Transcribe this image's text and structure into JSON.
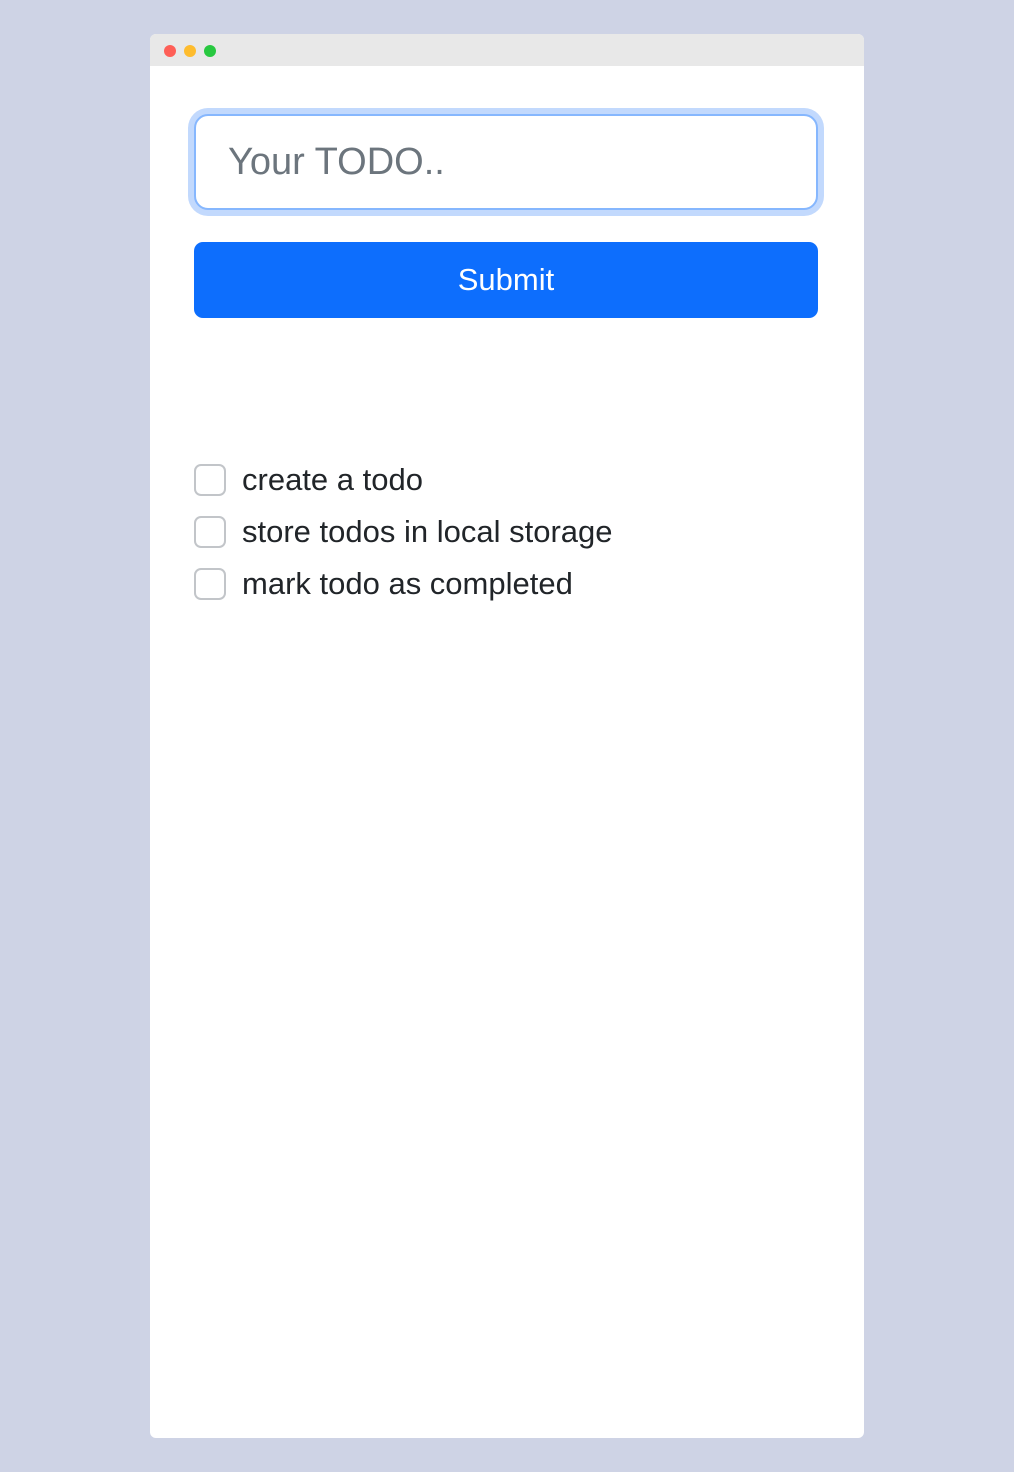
{
  "window": {
    "controls": [
      "close",
      "minimize",
      "zoom"
    ],
    "control_colors": {
      "close": "#fe5f57",
      "minimize": "#febc2e",
      "zoom": "#28c840"
    }
  },
  "form": {
    "input_placeholder": "Your TODO..",
    "input_value": "",
    "submit_label": "Submit",
    "accent_color": "#0d6efd"
  },
  "todos": [
    {
      "label": "create a todo",
      "checked": false
    },
    {
      "label": "store todos in local storage",
      "checked": false
    },
    {
      "label": "mark todo as completed",
      "checked": false
    }
  ]
}
